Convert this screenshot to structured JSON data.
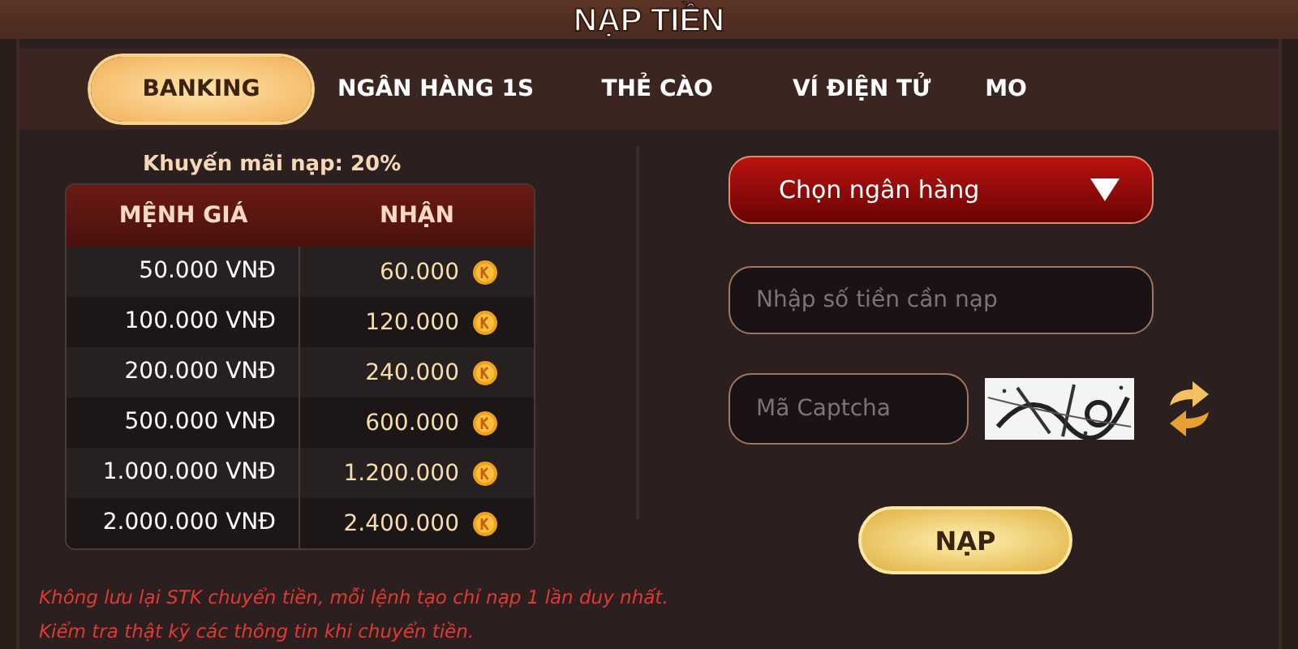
{
  "window": {
    "title": "NẠP TIỀN"
  },
  "tabs": [
    {
      "label": "BANKING",
      "selected": true
    },
    {
      "label": "NGÂN HÀNG 1S",
      "selected": false
    },
    {
      "label": "THẺ CÀO",
      "selected": false
    },
    {
      "label": "VÍ ĐIỆN TỬ",
      "selected": false
    },
    {
      "label": "MO",
      "selected": false
    }
  ],
  "promo": "Khuyến mãi nạp: 20%",
  "table": {
    "columns": [
      "MỆNH GIÁ",
      "NHẬN"
    ],
    "rows": [
      {
        "value": "50.000 VNĐ",
        "receive": "60.000"
      },
      {
        "value": "100.000 VNĐ",
        "receive": "120.000"
      },
      {
        "value": "200.000 VNĐ",
        "receive": "240.000"
      },
      {
        "value": "500.000 VNĐ",
        "receive": "600.000"
      },
      {
        "value": "1.000.000 VNĐ",
        "receive": "1.200.000"
      },
      {
        "value": "2.000.000 VNĐ",
        "receive": "2.400.000"
      }
    ]
  },
  "bank_select": {
    "value": "Chọn ngân hàng"
  },
  "amount_field": {
    "placeholder": "Nhập số tiền cần nạp"
  },
  "captcha_field": {
    "placeholder": "Mã Captcha"
  },
  "submit_button": "NẠP",
  "notes": [
    "Không lưu lại STK chuyển tiền, mỗi lệnh tạo chỉ nạp 1 lần duy nhất.",
    "Kiểm tra thật kỹ các thông tin khi chuyển tiền."
  ]
}
